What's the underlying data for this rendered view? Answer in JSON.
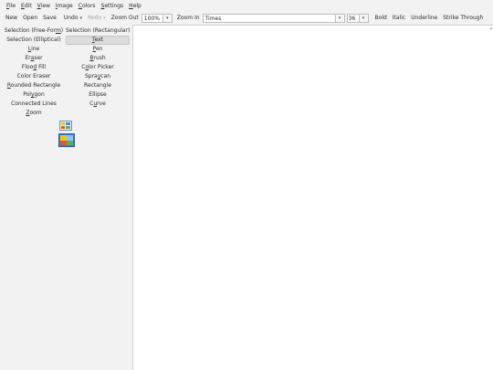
{
  "menubar": {
    "items": [
      {
        "u": "F",
        "rest": "ile"
      },
      {
        "u": "E",
        "rest": "dit"
      },
      {
        "u": "V",
        "rest": "iew"
      },
      {
        "u": "I",
        "rest": "mage"
      },
      {
        "u": "C",
        "rest": "olors"
      },
      {
        "u": "S",
        "rest": "ettings"
      },
      {
        "u": "H",
        "rest": "elp"
      }
    ]
  },
  "toolbar": {
    "new": "New",
    "open": "Open",
    "save": "Save",
    "undo": "Undo",
    "redo": "Redo",
    "zoom_out": "Zoom Out",
    "zoom_value": "100%",
    "zoom_in": "Zoom In",
    "font_name": "Times",
    "font_size": "36",
    "bold": "Bold",
    "italic": "Italic",
    "underline": "Underline",
    "strike": "Strike Through"
  },
  "tools": [
    {
      "pre": "Selection (Free-For",
      "u": "m",
      "post": ")"
    },
    {
      "pre": "Selection (Rectangular)",
      "u": "",
      "post": ""
    },
    {
      "pre": "Selection (Elliptical)",
      "u": "",
      "post": ""
    },
    {
      "pre": "",
      "u": "T",
      "post": "ext"
    },
    {
      "pre": "",
      "u": "L",
      "post": "ine"
    },
    {
      "pre": "",
      "u": "P",
      "post": "en"
    },
    {
      "pre": "Er",
      "u": "a",
      "post": "ser"
    },
    {
      "pre": "",
      "u": "B",
      "post": "rush"
    },
    {
      "pre": "Floo",
      "u": "d",
      "post": " Fill"
    },
    {
      "pre": "C",
      "u": "o",
      "post": "lor Picker"
    },
    {
      "pre": "Color Eraser",
      "u": "",
      "post": ""
    },
    {
      "pre": "Spra",
      "u": "y",
      "post": "can"
    },
    {
      "pre": "",
      "u": "R",
      "post": "ounded Rectangle"
    },
    {
      "pre": "Rectangle",
      "u": "",
      "post": ""
    },
    {
      "pre": "Pol",
      "u": "y",
      "post": "gon"
    },
    {
      "pre": "Ellipse",
      "u": "",
      "post": ""
    },
    {
      "pre": "Connected Lines",
      "u": "",
      "post": ""
    },
    {
      "pre": "C",
      "u": "u",
      "post": "rve"
    },
    {
      "pre": "",
      "u": "Z",
      "post": "oom"
    }
  ],
  "selected_tool_index": 3,
  "colors": {
    "swatch_small_icon": "palette-icon",
    "swatch_big_icon": "color-swap-icon"
  }
}
